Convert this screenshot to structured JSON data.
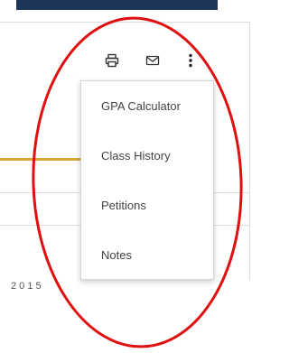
{
  "colors": {
    "top_bar": "#1d3557",
    "accent_gold": "#d4a737",
    "annotation_red": "#e01010"
  },
  "toolbar": {
    "print_icon": "printer-icon",
    "mail_icon": "envelope-icon",
    "more_icon": "more-vertical-icon"
  },
  "menu": {
    "items": [
      {
        "label": "GPA Calculator"
      },
      {
        "label": "Class History"
      },
      {
        "label": "Petitions"
      },
      {
        "label": "Notes"
      }
    ]
  },
  "background": {
    "partial_text": "2 0 1 5"
  }
}
